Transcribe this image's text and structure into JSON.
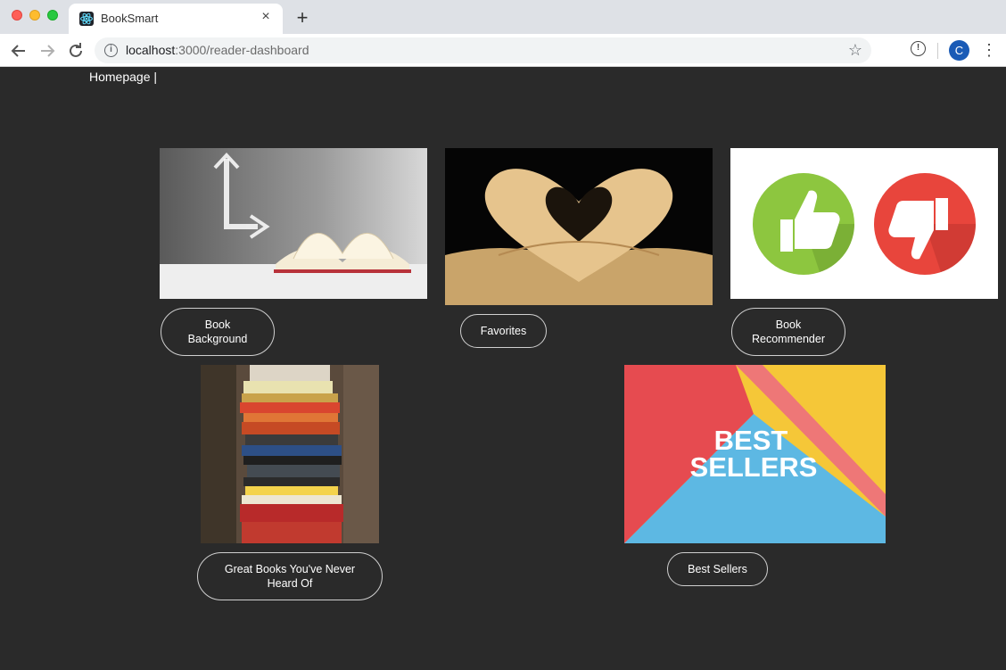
{
  "browser": {
    "tab_title": "BookSmart",
    "url_host": "localhost",
    "url_path": ":3000/reader-dashboard",
    "avatar_letter": "C",
    "new_tab_glyph": "+",
    "close_glyph": "×"
  },
  "nav": {
    "homepage_label": "Homepage |"
  },
  "cards": [
    {
      "id": "book-background",
      "label": "Book\nBackground",
      "image": "open-book-arrow"
    },
    {
      "id": "favorites",
      "label": "Favorites",
      "image": "heart-book"
    },
    {
      "id": "book-recommender",
      "label": "Book\nRecommender",
      "image": "thumbs-up-down"
    },
    {
      "id": "great-books",
      "label": "Great Books You've Never\nHeard Of",
      "image": "book-stack"
    },
    {
      "id": "best-sellers",
      "label": "Best Sellers",
      "image": "best-sellers-banner"
    }
  ],
  "banner": {
    "line1": "BEST",
    "line2": "SELLERS"
  },
  "colors": {
    "page_bg": "#2a2a2a",
    "thumb_up": "#8dc63f",
    "thumb_down": "#e8453c",
    "banner_red": "#e64b50",
    "banner_yellow": "#f5c738",
    "banner_blue": "#5db8e3"
  }
}
